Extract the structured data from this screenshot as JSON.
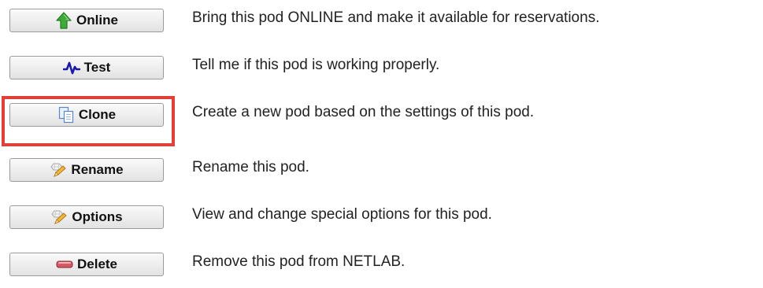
{
  "actions": [
    {
      "label": "Online",
      "icon": "up-arrow-icon",
      "description": "Bring this pod ONLINE and make it available for reservations."
    },
    {
      "label": "Test",
      "icon": "pulse-icon",
      "description": "Tell me if this pod is working properly."
    },
    {
      "label": "Clone",
      "icon": "copy-icon",
      "description": "Create a new pod based on the settings of this pod."
    },
    {
      "label": "Rename",
      "icon": "edit-icon",
      "description": "Rename this pod."
    },
    {
      "label": "Options",
      "icon": "options-icon",
      "description": "View and change special options for this pod."
    },
    {
      "label": "Delete",
      "icon": "delete-icon",
      "description": "Remove this pod from NETLAB."
    }
  ],
  "highlighted_action": "Clone",
  "colors": {
    "highlight": "#e0403a",
    "online_icon": "#3faa3a",
    "test_icon": "#1a1aa6",
    "delete_icon": "#c9414b"
  }
}
